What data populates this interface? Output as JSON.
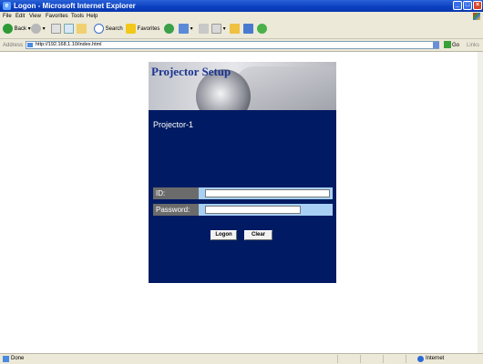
{
  "window": {
    "title": "Logon - Microsoft Internet Explorer",
    "buttons": {
      "minimize": "_",
      "maximize": "□",
      "close": "×"
    }
  },
  "menu": [
    "File",
    "Edit",
    "View",
    "Favorites",
    "Tools",
    "Help"
  ],
  "toolbar": {
    "back_label": "Back",
    "search_label": "Search",
    "favorites_label": "Favorites"
  },
  "address": {
    "label": "Address",
    "url": "http://192.168.1.10/index.html",
    "go_label": "Go",
    "links_label": "Links"
  },
  "page": {
    "banner_title": "Projector Setup",
    "projector_name": "Projector-1",
    "id_label": "ID:",
    "password_label": "Password:",
    "id_value": "",
    "password_value": "",
    "logon_button": "Logon",
    "clear_button": "Clear"
  },
  "status": {
    "text": "Done",
    "zone": "Internet"
  },
  "colors": {
    "panel_bg": "#001b63",
    "title_color": "#1c3590",
    "field_row_bg": "#a8d0f4",
    "label_bg": "#6b6b6b"
  }
}
